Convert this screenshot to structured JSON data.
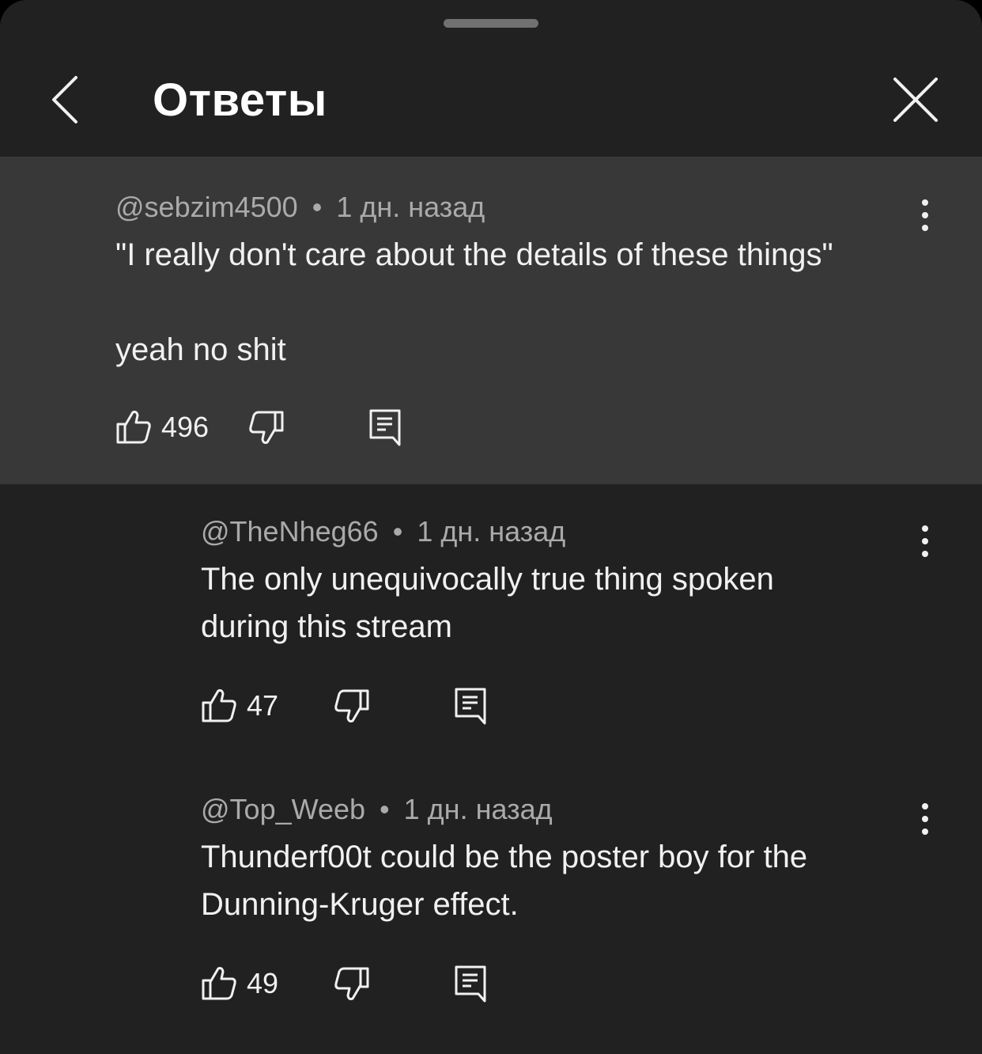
{
  "header": {
    "title": "Ответы"
  },
  "parent_comment": {
    "author": "@sebzim4500",
    "separator": "•",
    "time": "1 дн. назад",
    "text": "\"I really don't care about the details of these things\"\n\nyeah no shit",
    "likes": "496"
  },
  "replies": [
    {
      "author": "@TheNheg66",
      "separator": "•",
      "time": "1 дн. назад",
      "text": "The only unequivocally true thing spoken\nduring this stream",
      "likes": "47"
    },
    {
      "author": "@Top_Weeb",
      "separator": "•",
      "time": "1 дн. назад",
      "text": "Thunderf00t could be the poster boy for the\nDunning-Kruger effect.",
      "likes": "49"
    }
  ],
  "icons": {
    "back": "chevron-left-icon",
    "close": "close-icon",
    "more": "more-vertical-icon",
    "like": "thumbs-up-icon",
    "dislike": "thumbs-down-icon",
    "reply": "reply-comment-icon"
  },
  "colors": {
    "sheet_background": "#212121",
    "highlighted_comment_background": "#383838",
    "primary_text": "#f1f1f1",
    "secondary_text": "#aaaaaa"
  }
}
